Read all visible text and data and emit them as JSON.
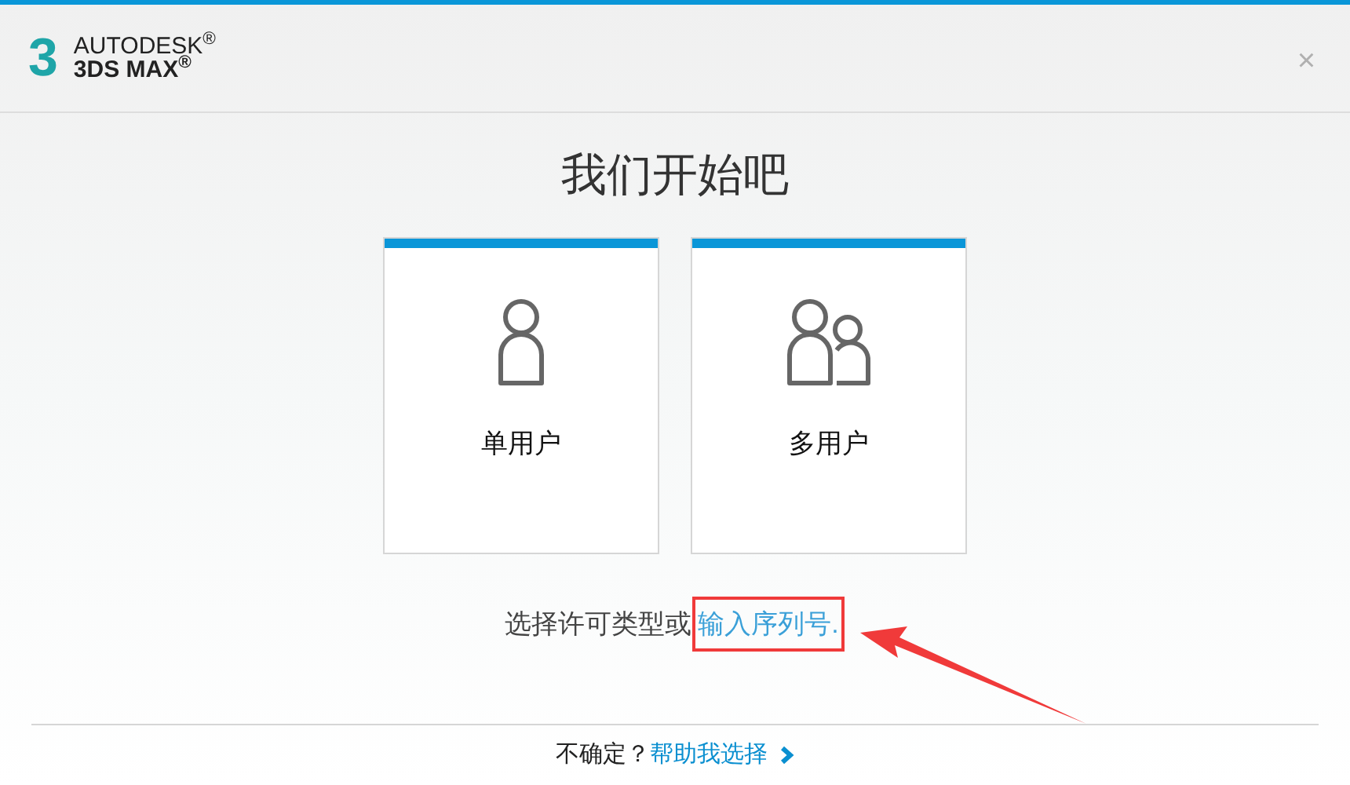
{
  "header": {
    "logo_mark": "3",
    "brand_top": "AUTODESK$^{®}$",
    "brand_bottom": "3DS MAX$^{®}$",
    "close": "×"
  },
  "title": "我们开始吧",
  "options": [
    {
      "kind": "single",
      "label": "单用户"
    },
    {
      "kind": "multi",
      "label": "多用户"
    }
  ],
  "prompt": {
    "text": "选择许可类型或",
    "link": "输入序列号.",
    "highlighted": true
  },
  "footer": {
    "text": "不确定？",
    "link": "帮助我选择"
  }
}
